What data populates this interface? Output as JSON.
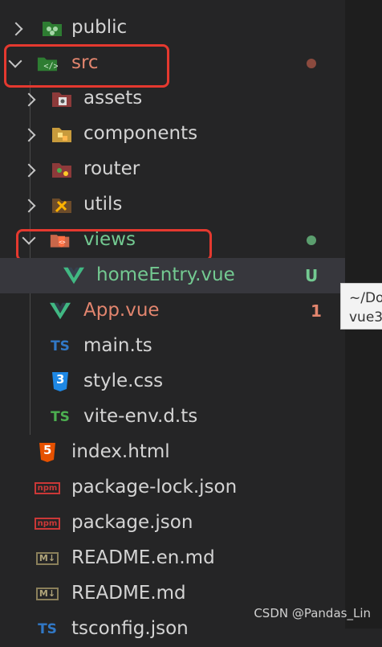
{
  "explorer": {
    "items": [
      {
        "label": "public"
      },
      {
        "label": "src"
      },
      {
        "label": "assets"
      },
      {
        "label": "components"
      },
      {
        "label": "router"
      },
      {
        "label": "utils"
      },
      {
        "label": "views"
      },
      {
        "label": "homeEntry.vue",
        "badge": "U"
      },
      {
        "label": "App.vue",
        "badge": "1"
      },
      {
        "label": "main.ts",
        "icon_text": "TS"
      },
      {
        "label": "style.css",
        "icon_text": "3"
      },
      {
        "label": "vite-env.d.ts",
        "icon_text": "TS"
      },
      {
        "label": "index.html",
        "icon_text": "5"
      },
      {
        "label": "package-lock.json",
        "icon_text": "npm"
      },
      {
        "label": "package.json",
        "icon_text": "npm"
      },
      {
        "label": "README.en.md",
        "icon_text": "M↓"
      },
      {
        "label": "README.md",
        "icon_text": "M↓"
      },
      {
        "label": "tsconfig.json",
        "icon_text": "TS"
      }
    ]
  },
  "tooltip": {
    "line1": "~/Do",
    "line2": "vue3"
  },
  "watermark": "CSDN @Pandas_Lin",
  "colors": {
    "modified": "#e2856e",
    "untracked": "#73c991",
    "highlight_box": "#e5392f"
  }
}
